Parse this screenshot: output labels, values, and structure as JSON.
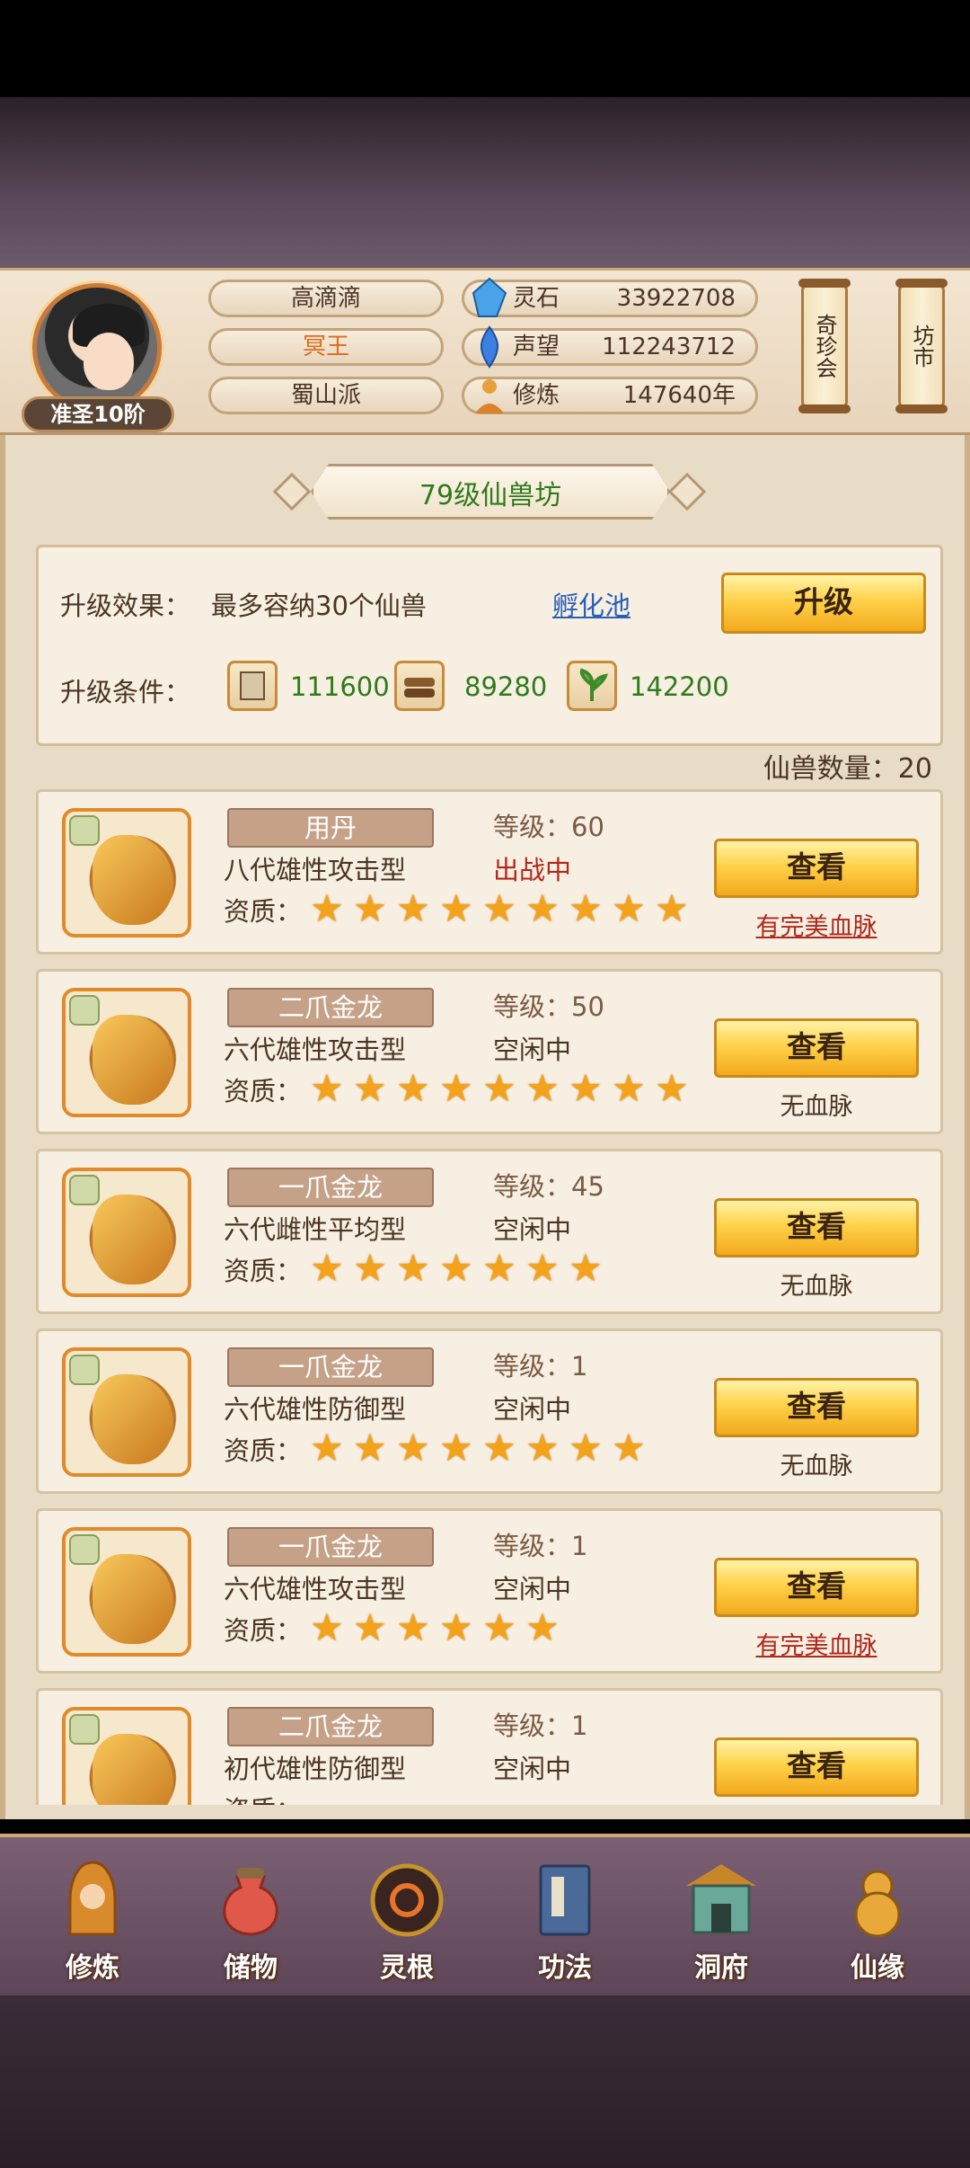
{
  "header": {
    "rank": "准圣10阶",
    "name": "高滴滴",
    "title": "冥王",
    "sect": "蜀山派",
    "resources": [
      {
        "icon": "spirit-stone-icon",
        "label": "灵石",
        "value": "33922708"
      },
      {
        "icon": "reputation-icon",
        "label": "声望",
        "value": "112243712"
      },
      {
        "icon": "cultivation-icon",
        "label": "修炼",
        "value": "147640年"
      }
    ],
    "side_buttons": [
      "奇珍会",
      "坊市"
    ]
  },
  "panel": {
    "title": "79级仙兽坊",
    "effect_label": "升级效果：",
    "effect_text": "最多容纳30个仙兽",
    "link": "孵化池",
    "upgrade_button": "升级",
    "cond_label": "升级条件：",
    "conditions": [
      {
        "icon": "scroll-material-icon",
        "value": "111600"
      },
      {
        "icon": "wood-material-icon",
        "value": "89280"
      },
      {
        "icon": "herb-material-icon",
        "value": "142200"
      }
    ],
    "count_text": "仙兽数量：20"
  },
  "beasts": [
    {
      "name": "用丹",
      "desc": "八代雄性攻击型",
      "level": "等级：60",
      "status": "出战中",
      "status_type": "busy",
      "apt_label": "资质：",
      "stars": 9,
      "button": "查看",
      "blood": "有完美血脉",
      "blood_type": "perfect"
    },
    {
      "name": "二爪金龙",
      "desc": "六代雄性攻击型",
      "level": "等级：50",
      "status": "空闲中",
      "status_type": "idle",
      "apt_label": "资质：",
      "stars": 9,
      "button": "查看",
      "blood": "无血脉",
      "blood_type": "none"
    },
    {
      "name": "一爪金龙",
      "desc": "六代雌性平均型",
      "level": "等级：45",
      "status": "空闲中",
      "status_type": "idle",
      "apt_label": "资质：",
      "stars": 7,
      "button": "查看",
      "blood": "无血脉",
      "blood_type": "none"
    },
    {
      "name": "一爪金龙",
      "desc": "六代雄性防御型",
      "level": "等级：1",
      "status": "空闲中",
      "status_type": "idle",
      "apt_label": "资质：",
      "stars": 8,
      "button": "查看",
      "blood": "无血脉",
      "blood_type": "none"
    },
    {
      "name": "一爪金龙",
      "desc": "六代雄性攻击型",
      "level": "等级：1",
      "status": "空闲中",
      "status_type": "idle",
      "apt_label": "资质：",
      "stars": 6,
      "button": "查看",
      "blood": "有完美血脉",
      "blood_type": "perfect"
    },
    {
      "name": "二爪金龙",
      "desc": "初代雄性防御型",
      "level": "等级：1",
      "status": "空闲中",
      "status_type": "idle",
      "apt_label": "资质：",
      "stars": 0,
      "button": "查看",
      "blood": "",
      "blood_type": "none"
    }
  ],
  "nav": [
    {
      "icon": "cultivate-icon",
      "label": "修炼"
    },
    {
      "icon": "storage-bag-icon",
      "label": "储物"
    },
    {
      "icon": "spirit-root-icon",
      "label": "灵根"
    },
    {
      "icon": "technique-book-icon",
      "label": "功法"
    },
    {
      "icon": "cave-mansion-icon",
      "label": "洞府"
    },
    {
      "icon": "fortune-gourd-icon",
      "label": "仙缘"
    }
  ],
  "colors": {
    "accent_gold": "#ffd24a",
    "busy_red": "#b0281c",
    "link_blue": "#2a5fb5",
    "value_green": "#2f7a1c"
  }
}
